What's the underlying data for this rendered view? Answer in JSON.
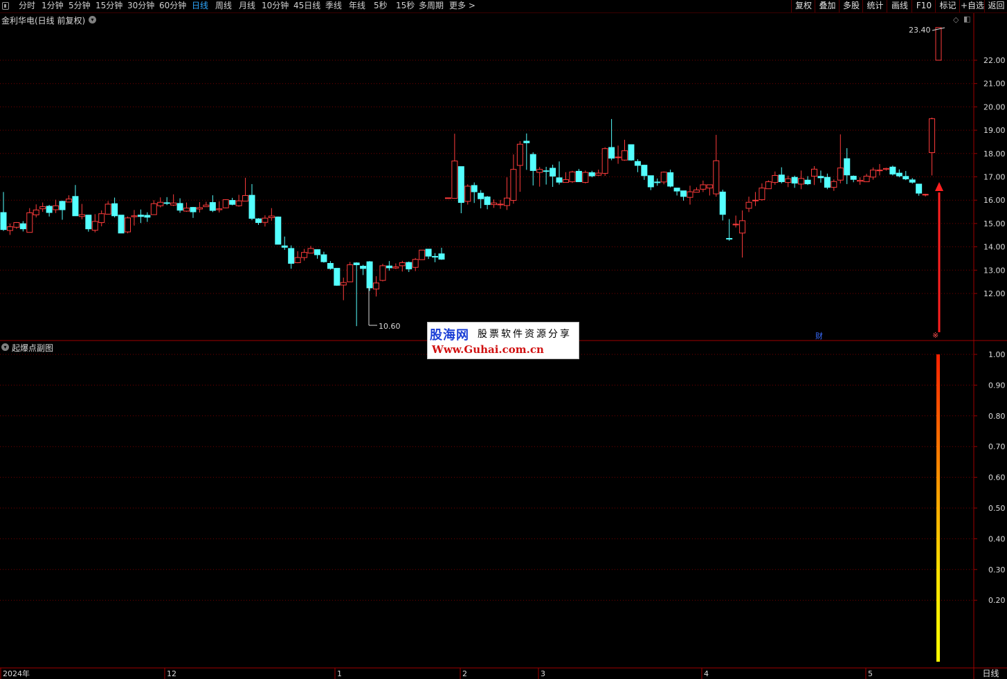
{
  "toolbar": {
    "items": [
      "分时",
      "1分钟",
      "5分钟",
      "15分钟",
      "30分钟",
      "60分钟",
      "日线",
      "周线",
      "月线",
      "10分钟",
      "45日线",
      "季线",
      "年线",
      "5秒",
      "15秒",
      "多周期",
      "更多 >"
    ],
    "active": "日线",
    "right_items": [
      "复权",
      "叠加",
      "多股",
      "统计",
      "画线",
      "F10",
      "标记",
      "+自选",
      "返回"
    ]
  },
  "main_chart": {
    "title": "金利华电(日线 前复权)",
    "y_ticks": [
      "22.00",
      "21.00",
      "20.00",
      "19.00",
      "18.00",
      "17.00",
      "16.00",
      "15.00",
      "14.00",
      "13.00",
      "12.00"
    ],
    "high_label": "23.40",
    "low_label": "10.60",
    "markers": {
      "fin": "财",
      "x": "※"
    }
  },
  "sub_chart": {
    "title": "起爆点副图",
    "y_ticks": [
      "1.00",
      "0.90",
      "0.80",
      "0.70",
      "0.60",
      "0.50",
      "0.40",
      "0.30",
      "0.20"
    ]
  },
  "x_axis": {
    "labels": [
      "2024年",
      "12",
      "1",
      "2",
      "3",
      "4",
      "5"
    ],
    "period": "日线"
  },
  "watermark": {
    "brand": "股海网",
    "tagline": "股票软件资源分享",
    "url": "Www.Guhai.com.cn"
  },
  "colors": {
    "up": "#ff3c3c",
    "down": "#54ffff",
    "grid": "#7a0000",
    "frame": "#a00000"
  },
  "chart_data": {
    "type": "candlestick",
    "y_range": [
      10.6,
      23.4
    ],
    "candles": [
      [
        15.47,
        14.74,
        16.35,
        14.68
      ],
      [
        14.7,
        14.86,
        15.0,
        14.51
      ],
      [
        14.84,
        15.04,
        15.06,
        14.77
      ],
      [
        14.99,
        14.77,
        15.1,
        14.66
      ],
      [
        14.62,
        15.46,
        15.66,
        14.62
      ],
      [
        15.37,
        15.58,
        15.82,
        15.26
      ],
      [
        15.63,
        15.72,
        15.9,
        15.5
      ],
      [
        15.74,
        15.47,
        15.8,
        15.3
      ],
      [
        15.59,
        15.76,
        16.02,
        15.45
      ],
      [
        15.95,
        15.59,
        15.98,
        15.16
      ],
      [
        15.92,
        16.05,
        16.21,
        15.91
      ],
      [
        16.16,
        15.33,
        16.65,
        15.33
      ],
      [
        15.3,
        15.38,
        15.84,
        15.18
      ],
      [
        15.36,
        14.77,
        15.37,
        14.65
      ],
      [
        14.71,
        15.09,
        15.4,
        14.62
      ],
      [
        15.04,
        15.42,
        15.56,
        14.88
      ],
      [
        15.4,
        15.83,
        15.96,
        15.39
      ],
      [
        15.85,
        15.33,
        16.11,
        15.26
      ],
      [
        15.36,
        14.59,
        15.36,
        14.58
      ],
      [
        14.64,
        15.24,
        15.3,
        14.58
      ],
      [
        15.29,
        15.33,
        15.58,
        14.91
      ],
      [
        15.36,
        15.3,
        15.6,
        15.02
      ],
      [
        15.35,
        15.27,
        15.48,
        15.07
      ],
      [
        15.38,
        15.85,
        16.0,
        15.38
      ],
      [
        15.76,
        15.91,
        16.12,
        15.69
      ],
      [
        15.89,
        15.86,
        16.13,
        15.79
      ],
      [
        15.79,
        15.88,
        16.25,
        15.75
      ],
      [
        15.86,
        15.57,
        16.08,
        15.46
      ],
      [
        15.53,
        15.66,
        15.9,
        15.5
      ],
      [
        15.69,
        15.5,
        15.71,
        15.24
      ],
      [
        15.62,
        15.68,
        15.92,
        15.47
      ],
      [
        15.72,
        15.79,
        15.93,
        15.72
      ],
      [
        15.9,
        15.56,
        16.21,
        15.49
      ],
      [
        15.59,
        15.63,
        15.95,
        15.47
      ],
      [
        15.67,
        16.02,
        16.04,
        15.65
      ],
      [
        15.99,
        15.82,
        16.1,
        15.78
      ],
      [
        15.76,
        15.97,
        16.23,
        15.72
      ],
      [
        15.96,
        16.2,
        16.96,
        15.95
      ],
      [
        16.21,
        15.22,
        16.69,
        15.14
      ],
      [
        15.2,
        15.04,
        15.23,
        14.94
      ],
      [
        15.05,
        15.23,
        15.35,
        14.87
      ],
      [
        15.25,
        15.32,
        15.66,
        15.12
      ],
      [
        15.28,
        14.11,
        15.3,
        14.1
      ],
      [
        14.04,
        13.98,
        14.44,
        13.87
      ],
      [
        13.93,
        13.29,
        14.06,
        13.06
      ],
      [
        13.32,
        13.54,
        13.81,
        13.3
      ],
      [
        13.54,
        13.76,
        13.91,
        13.41
      ],
      [
        13.73,
        13.93,
        14.04,
        13.72
      ],
      [
        13.88,
        13.66,
        13.89,
        13.49
      ],
      [
        13.66,
        13.36,
        13.79,
        13.32
      ],
      [
        13.29,
        13.07,
        13.39,
        13.02
      ],
      [
        13.08,
        12.35,
        13.08,
        12.33
      ],
      [
        12.36,
        12.47,
        12.68,
        11.71
      ],
      [
        12.5,
        13.23,
        13.35,
        12.5
      ],
      [
        13.31,
        13.23,
        13.34,
        10.6
      ],
      [
        13.17,
        13.07,
        13.23,
        12.79
      ],
      [
        13.36,
        12.24,
        13.39,
        12.11
      ],
      [
        12.19,
        12.45,
        12.74,
        11.87
      ],
      [
        12.56,
        13.19,
        13.27,
        12.52
      ],
      [
        13.18,
        13.1,
        13.39,
        12.98
      ],
      [
        13.09,
        13.14,
        13.29,
        13.05
      ],
      [
        13.19,
        13.32,
        13.4,
        12.94
      ],
      [
        13.33,
        13.05,
        13.37,
        12.92
      ],
      [
        13.12,
        13.46,
        13.52,
        12.96
      ],
      [
        13.45,
        13.86,
        13.87,
        13.45
      ],
      [
        13.9,
        13.6,
        13.91,
        13.48
      ],
      [
        13.59,
        13.56,
        13.73,
        13.34
      ],
      [
        13.7,
        13.47,
        13.96,
        13.44
      ],
      [
        16.1,
        16.1,
        16.1,
        16.1
      ],
      [
        16.08,
        17.68,
        18.85,
        16.68
      ],
      [
        17.44,
        15.9,
        17.44,
        15.44
      ],
      [
        15.95,
        16.6,
        16.68,
        15.81
      ],
      [
        16.63,
        16.36,
        16.76,
        15.88
      ],
      [
        16.3,
        16.06,
        16.43,
        15.65
      ],
      [
        16.14,
        15.81,
        16.18,
        15.61
      ],
      [
        15.81,
        15.88,
        16.03,
        15.67
      ],
      [
        15.8,
        15.83,
        16.01,
        15.63
      ],
      [
        15.77,
        16.09,
        16.98,
        15.58
      ],
      [
        15.99,
        17.32,
        17.96,
        15.85
      ],
      [
        17.49,
        18.4,
        18.53,
        16.36
      ],
      [
        18.53,
        18.46,
        18.86,
        17.3
      ],
      [
        17.96,
        17.27,
        18.05,
        16.63
      ],
      [
        17.19,
        17.32,
        17.42,
        16.58
      ],
      [
        17.26,
        17.24,
        17.43,
        16.67
      ],
      [
        17.37,
        17.03,
        17.52,
        16.57
      ],
      [
        16.96,
        16.77,
        17.66,
        16.67
      ],
      [
        16.76,
        16.88,
        17.2,
        16.75
      ],
      [
        16.79,
        17.21,
        17.26,
        16.74
      ],
      [
        17.24,
        16.79,
        17.34,
        16.79
      ],
      [
        16.76,
        17.19,
        17.27,
        16.72
      ],
      [
        17.18,
        17.04,
        17.26,
        16.98
      ],
      [
        17.07,
        17.16,
        17.31,
        17.04
      ],
      [
        17.15,
        18.21,
        18.27,
        17.04
      ],
      [
        18.26,
        17.8,
        19.48,
        17.71
      ],
      [
        17.82,
        17.85,
        18.34,
        17.56
      ],
      [
        17.72,
        18.12,
        18.59,
        17.69
      ],
      [
        18.38,
        17.72,
        18.38,
        17.69
      ],
      [
        17.66,
        17.49,
        17.76,
        17.2
      ],
      [
        17.5,
        17.05,
        17.52,
        16.87
      ],
      [
        17.05,
        16.57,
        17.06,
        16.43
      ],
      [
        16.78,
        16.77,
        16.93,
        16.62
      ],
      [
        16.78,
        17.2,
        17.23,
        16.68
      ],
      [
        17.18,
        16.6,
        17.31,
        16.55
      ],
      [
        16.52,
        16.39,
        16.48,
        16.2
      ],
      [
        16.4,
        16.16,
        16.4,
        15.98
      ],
      [
        16.12,
        16.36,
        16.62,
        15.81
      ],
      [
        16.34,
        16.44,
        16.55,
        16.34
      ],
      [
        16.47,
        16.66,
        16.84,
        16.35
      ],
      [
        16.52,
        16.66,
        16.66,
        16.2
      ],
      [
        16.27,
        17.69,
        18.8,
        16.15
      ],
      [
        16.35,
        15.39,
        16.45,
        15.13
      ],
      [
        14.36,
        14.34,
        14.26,
        15.19
      ],
      [
        14.97,
        14.97,
        15.34,
        14.83
      ],
      [
        14.59,
        15.12,
        15.56,
        13.54
      ],
      [
        15.65,
        15.91,
        16.15,
        15.49
      ],
      [
        15.98,
        16.0,
        16.35,
        15.75
      ],
      [
        16.02,
        16.52,
        16.72,
        15.98
      ],
      [
        16.49,
        16.79,
        16.85,
        16.52
      ],
      [
        16.76,
        17.06,
        17.23,
        16.66
      ],
      [
        17.08,
        16.79,
        17.41,
        16.72
      ],
      [
        16.76,
        16.92,
        17.05,
        16.56
      ],
      [
        16.98,
        16.73,
        17.05,
        16.53
      ],
      [
        16.69,
        16.93,
        17.27,
        16.47
      ],
      [
        16.86,
        16.7,
        17.03,
        16.65
      ],
      [
        17.03,
        17.33,
        17.46,
        16.65
      ],
      [
        17.02,
        16.96,
        17.27,
        16.75
      ],
      [
        16.98,
        16.55,
        17.14,
        16.47
      ],
      [
        16.55,
        16.8,
        16.89,
        16.4
      ],
      [
        16.86,
        17.38,
        18.82,
        16.72
      ],
      [
        17.78,
        17.08,
        18.23,
        16.69
      ],
      [
        17.03,
        16.89,
        17.06,
        16.77
      ],
      [
        16.81,
        16.85,
        16.98,
        16.66
      ],
      [
        16.79,
        17.03,
        17.13,
        16.96
      ],
      [
        16.99,
        17.29,
        17.4,
        16.88
      ],
      [
        17.29,
        17.29,
        17.55,
        17.06
      ],
      [
        17.32,
        17.36,
        17.39,
        17.27
      ],
      [
        17.42,
        17.12,
        17.48,
        17.06
      ],
      [
        17.16,
        17.04,
        17.32,
        16.98
      ],
      [
        17.02,
        16.91,
        17.25,
        16.86
      ],
      [
        16.87,
        16.77,
        16.95,
        16.71
      ],
      [
        16.69,
        16.3,
        16.7,
        16.19
      ],
      [
        16.24,
        16.25,
        16.27,
        16.16
      ],
      [
        18.04,
        19.49,
        19.54,
        17.06
      ],
      [
        22.0,
        23.4,
        23.4,
        22.0
      ]
    ],
    "sub_series": {
      "name": "起爆点",
      "value_at_last_signal": 1.0,
      "range": [
        0.0,
        1.0
      ]
    }
  }
}
